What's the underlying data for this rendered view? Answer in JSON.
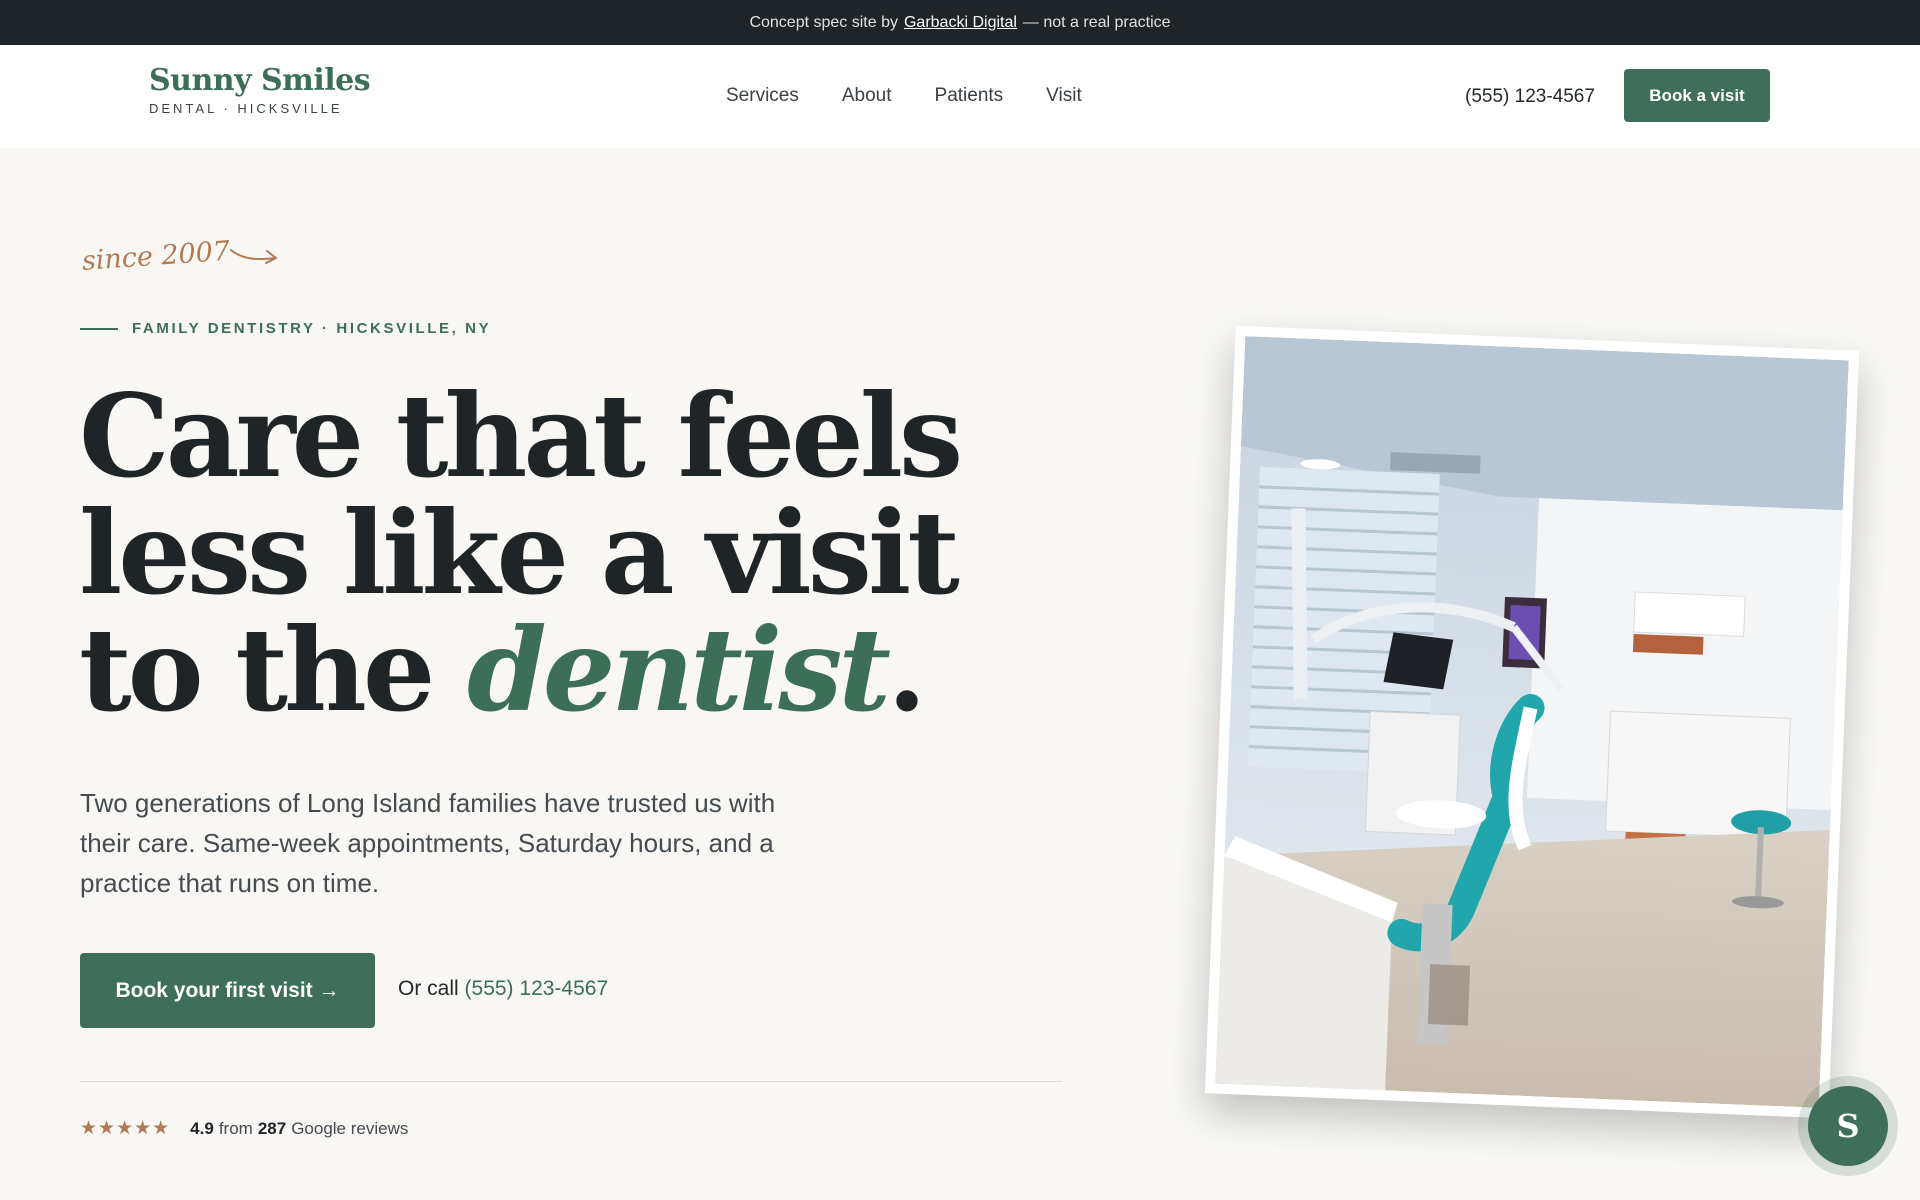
{
  "banner": {
    "prefix": "Concept spec site by",
    "link": "Garbacki Digital",
    "suffix": "— not a real practice"
  },
  "header": {
    "logo_name": "Sunny Smiles",
    "logo_sub": "DENTAL · HICKSVILLE",
    "nav": [
      "Services",
      "About",
      "Patients",
      "Visit"
    ],
    "phone": "(555) 123-4567",
    "book_label": "Book a visit"
  },
  "hero": {
    "since": "since 2007",
    "eyebrow": "FAMILY DENTISTRY · HICKSVILLE, NY",
    "headline_line1": "Care that feels",
    "headline_line2": "less like a visit",
    "headline_line3_prefix": "to the ",
    "headline_accent": "dentist",
    "headline_end": ".",
    "lede": "Two generations of Long Island families have trusted us with their care. Same-week appointments, Saturday hours, and a practice that runs on time.",
    "cta_label": "Book your first visit →",
    "call_prefix": "Or call",
    "call_number": "(555) 123-4567"
  },
  "rating": {
    "stars": "★★★★★",
    "score": "4.9",
    "from": "from",
    "count": "287",
    "source": "Google reviews"
  },
  "photo": {
    "icon": "dental-office-photo"
  },
  "chat_badge": {
    "letter": "S"
  },
  "colors": {
    "brand_green": "#3f6e5b",
    "accent_copper": "#b07a55",
    "banner_bg": "#1e2428",
    "page_bg": "#f8f7f3"
  }
}
